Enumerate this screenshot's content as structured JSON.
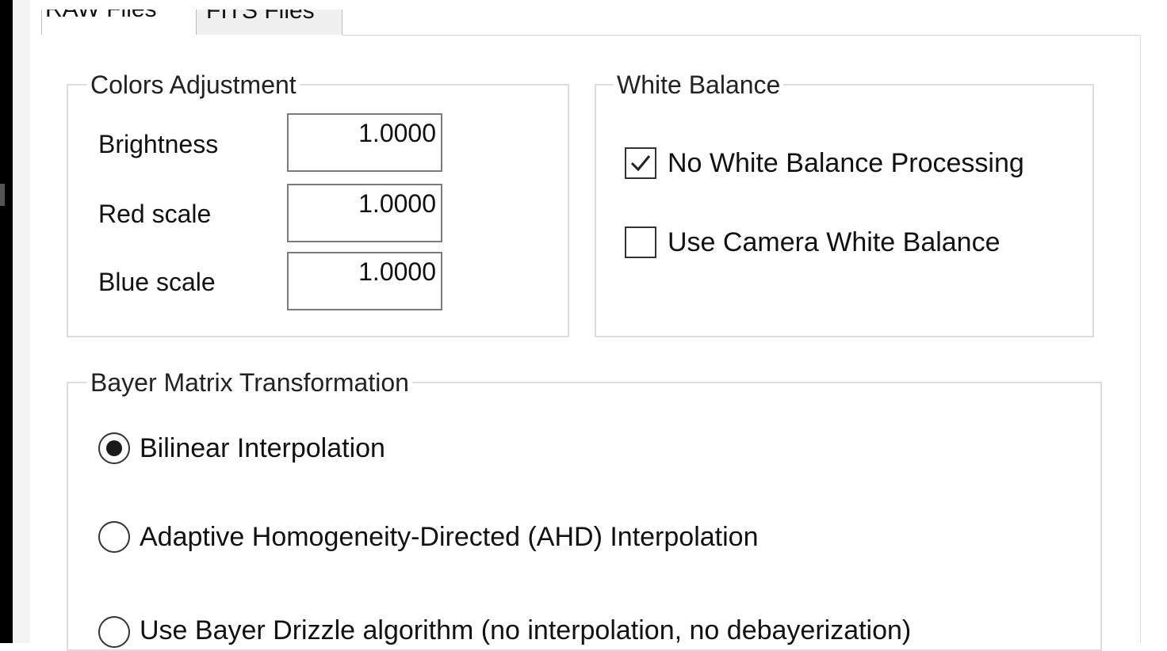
{
  "tabs": [
    {
      "label": "RAW Files",
      "selected": true
    },
    {
      "label": "FITS Files",
      "selected": false
    }
  ],
  "colors_adjustment": {
    "title": "Colors Adjustment",
    "fields": [
      {
        "label": "Brightness",
        "value": "1.0000"
      },
      {
        "label": "Red scale",
        "value": "1.0000"
      },
      {
        "label": "Blue scale",
        "value": "1.0000"
      }
    ]
  },
  "white_balance": {
    "title": "White Balance",
    "options": [
      {
        "label": "No White Balance Processing",
        "checked": true
      },
      {
        "label": "Use Camera White Balance",
        "checked": false
      }
    ]
  },
  "bayer": {
    "title": "Bayer Matrix Transformation",
    "options": [
      {
        "label": "Bilinear Interpolation",
        "selected": true
      },
      {
        "label": "Adaptive Homogeneity-Directed (AHD) Interpolation",
        "selected": false
      },
      {
        "label": "Use Bayer Drizzle algorithm (no interpolation, no debayerization)",
        "selected": false
      }
    ]
  }
}
